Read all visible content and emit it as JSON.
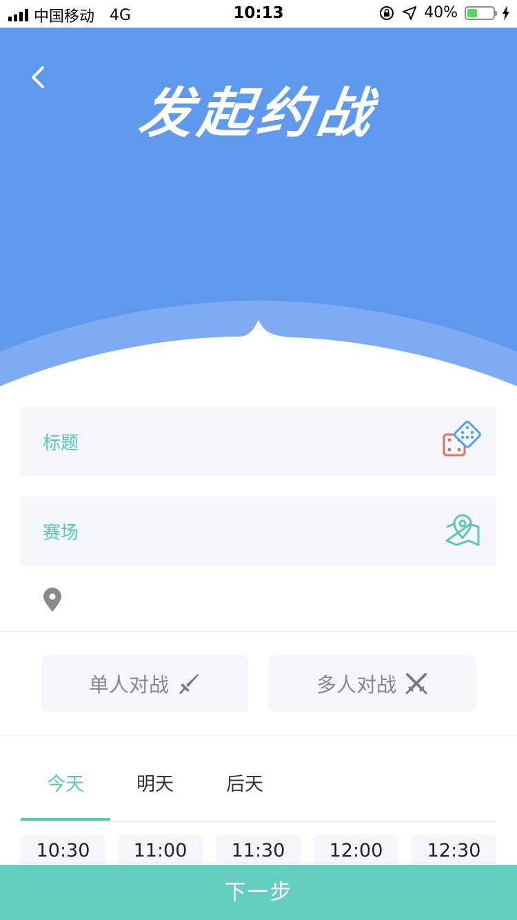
{
  "status_bar": {
    "carrier": "中国移动",
    "network": "4G",
    "time": "10:13",
    "battery": "40%"
  },
  "header": {
    "title": "发起约战",
    "back_icon": "chevron-left-icon",
    "background_color": "#5f99ed",
    "wave_color": "#7eabf1"
  },
  "form": {
    "title_label": "标题",
    "title_icon": "dice-icon",
    "venue_label": "赛场",
    "venue_icon": "map-pin-icon",
    "location_icon": "location-pin-icon",
    "label_color": "#58c8b6"
  },
  "modes": {
    "single": {
      "label": "单人对战",
      "icon": "sword-icon"
    },
    "multi": {
      "label": "多人对战",
      "icon": "crossed-swords-icon"
    }
  },
  "date_tabs": [
    {
      "label": "今天",
      "active": true
    },
    {
      "label": "明天",
      "active": false
    },
    {
      "label": "后天",
      "active": false
    }
  ],
  "time_slots": [
    "10:30",
    "11:00",
    "11:30",
    "12:00",
    "12:30"
  ],
  "next_button": {
    "label": "下一步",
    "color": "#64cdbd"
  }
}
